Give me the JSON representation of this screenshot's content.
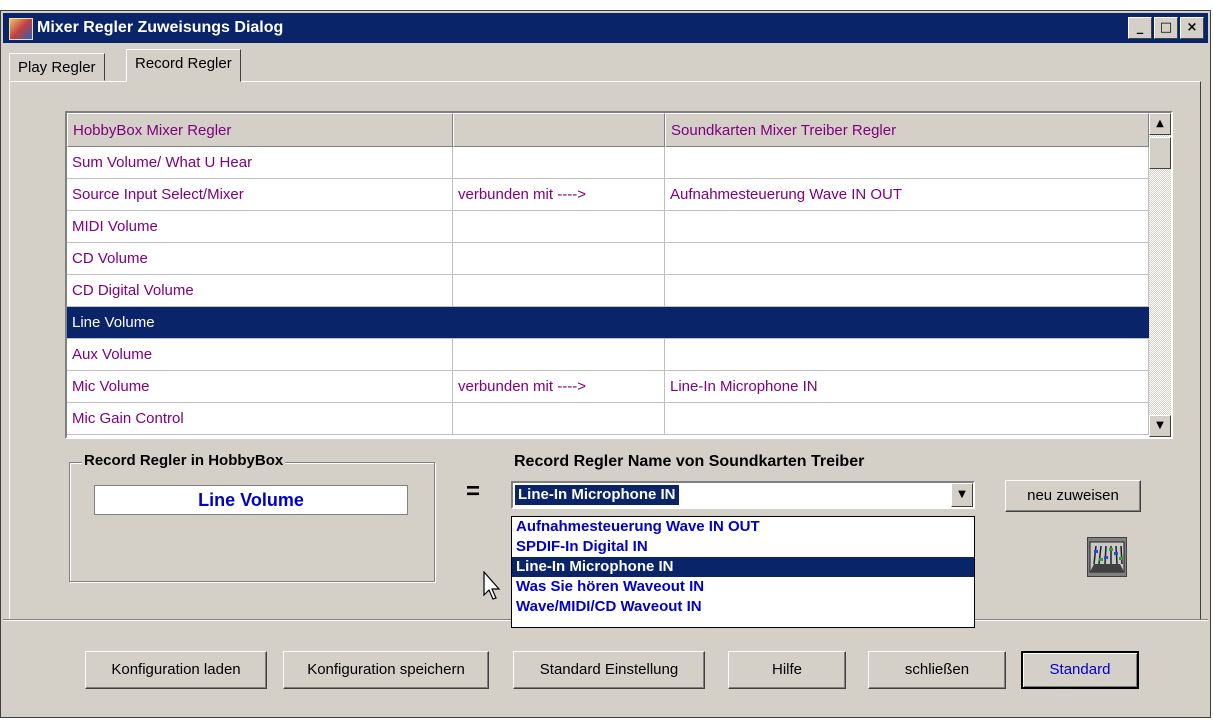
{
  "window": {
    "title": "Mixer Regler  Zuweisungs  Dialog",
    "controls": {
      "minimize": "_",
      "maximize": "□",
      "close": "×"
    }
  },
  "tabs": [
    {
      "label": "Play Regler",
      "active": false
    },
    {
      "label": "Record Regler",
      "active": true
    }
  ],
  "grid": {
    "headers": [
      "HobbyBox Mixer Regler",
      "",
      "Soundkarten Mixer Treiber Regler"
    ],
    "rows": [
      [
        "Sum Volume/ What U Hear",
        "",
        ""
      ],
      [
        "Source Input Select/Mixer",
        "verbunden mit ---->",
        "Aufnahmesteuerung Wave IN OUT"
      ],
      [
        "MIDI Volume",
        "",
        ""
      ],
      [
        "CD Volume",
        "",
        ""
      ],
      [
        "CD Digital Volume",
        "",
        ""
      ],
      [
        "Line Volume",
        "",
        ""
      ],
      [
        "Aux Volume",
        "",
        ""
      ],
      [
        "Mic Volume",
        "verbunden mit ---->",
        "Line-In Microphone IN"
      ],
      [
        "Mic Gain Control",
        "",
        ""
      ]
    ],
    "selected_row_index": 5,
    "scroll_up": "▲",
    "scroll_down": "▼"
  },
  "hobbybox_group": {
    "label": "Record Regler in  HobbyBox",
    "value": "Line Volume"
  },
  "equals": "=",
  "soundcard": {
    "label": "Record Regler Name von Soundkarten Treiber",
    "selected": "Line-In Microphone IN",
    "dropdown_arrow": "▼",
    "options": [
      "Aufnahmesteuerung Wave IN OUT",
      "SPDIF-In Digital IN",
      "Line-In Microphone IN",
      "Was Sie hören Waveout IN",
      "Wave/MIDI/CD Waveout IN"
    ],
    "highlighted_option_index": 2
  },
  "reassign_button": "neu zuweisen",
  "bottom_buttons": {
    "load": "Konfiguration laden",
    "save": "Konfiguration speichern",
    "defaults": "Standard Einstellung",
    "help": "Hilfe",
    "close": "schließen",
    "standard": "Standard"
  },
  "colors": {
    "selection": "#0a246a",
    "row_text": "#800080",
    "value_text": "#0000cc",
    "face": "#d4d0c8"
  }
}
